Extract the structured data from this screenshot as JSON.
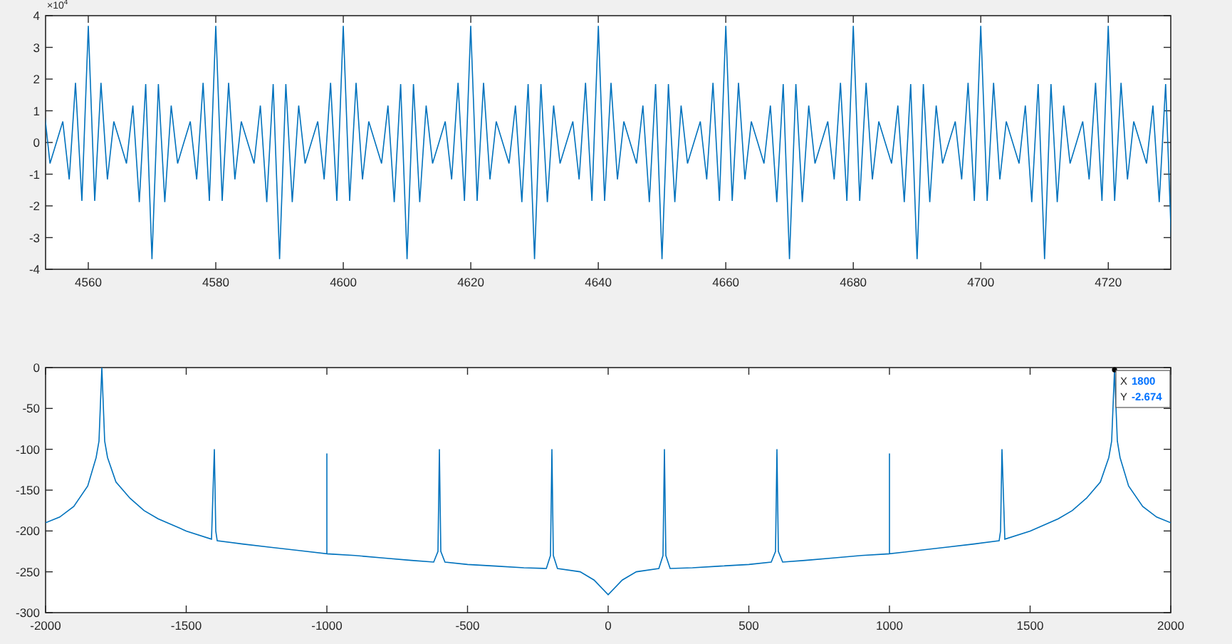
{
  "figure": {
    "plots": [
      {
        "kind": "waveform",
        "exponent": "×10$^{4}$",
        "x_ticks": [
          "4560",
          "4580",
          "4600",
          "4620",
          "4640",
          "4660",
          "4680",
          "4700",
          "4720"
        ],
        "y_ticks": [
          "4",
          "3",
          "2",
          "1",
          "0",
          "-1",
          "-2",
          "-3",
          "-4"
        ]
      },
      {
        "kind": "spectrum",
        "chart_data": {
          "type": "line",
          "x": [
            -2000,
            -1950,
            -1900,
            -1850,
            -1820,
            -1810,
            -1800,
            -1790,
            -1780,
            -1750,
            -1700,
            -1650,
            -1600,
            -1500,
            -1410,
            -1400,
            -1395,
            -1390,
            -1300,
            -1200,
            -1100,
            -1000,
            -1000,
            -1000,
            -900,
            -800,
            -700,
            -620,
            -605,
            -600,
            -595,
            -580,
            -500,
            -400,
            -300,
            -220,
            -205,
            -200,
            -195,
            -180,
            -100,
            -50,
            0,
            50,
            100,
            180,
            195,
            200,
            205,
            220,
            300,
            400,
            500,
            580,
            595,
            600,
            605,
            620,
            700,
            800,
            900,
            1000,
            1000,
            1000,
            1100,
            1200,
            1300,
            1390,
            1395,
            1400,
            1410,
            1500,
            1600,
            1650,
            1700,
            1750,
            1780,
            1790,
            1800,
            1810,
            1820,
            1850,
            1900,
            1950,
            2000
          ],
          "series": [
            {
              "color": "#0072bd",
              "values": [
                -190,
                -183,
                -170,
                -145,
                -110,
                -90,
                0,
                -90,
                -110,
                -140,
                -160,
                -175,
                -185,
                -200,
                -210,
                -100,
                -200,
                -212,
                -216,
                -220,
                -224,
                -228,
                -105,
                -228,
                -230,
                -233,
                -236,
                -238,
                -225,
                -100,
                -225,
                -238,
                -241,
                -243,
                -245,
                -246,
                -230,
                -100,
                -230,
                -246,
                -250,
                -260,
                -278,
                -260,
                -250,
                -246,
                -230,
                -100,
                -230,
                -246,
                -245,
                -243,
                -241,
                -238,
                -225,
                -100,
                -225,
                -238,
                -236,
                -233,
                -230,
                -228,
                -105,
                -228,
                -224,
                -220,
                -216,
                -212,
                -200,
                -100,
                -210,
                -200,
                -185,
                -175,
                -160,
                -140,
                -110,
                -90,
                -3,
                -90,
                -110,
                -145,
                -170,
                -183,
                -190
              ]
            }
          ],
          "xlim": [
            -2000,
            2000
          ],
          "ylim": [
            -300,
            0
          ],
          "xticks": [
            -2000,
            -1500,
            -1000,
            -500,
            0,
            500,
            1000,
            1500,
            2000
          ],
          "yticks": [
            0,
            -50,
            -100,
            -150,
            -200,
            -250,
            -300
          ]
        },
        "datatip": {
          "x_label": "X",
          "x_value": "1800",
          "y_label": "Y",
          "y_value": "-2.674"
        }
      }
    ]
  }
}
